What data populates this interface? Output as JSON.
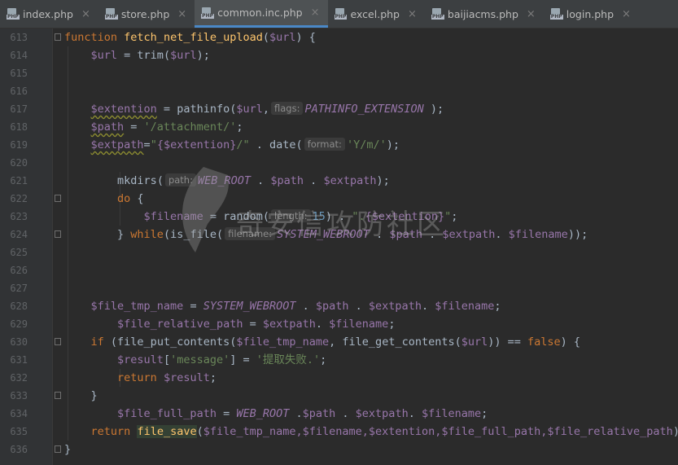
{
  "tabs": [
    {
      "label": "index.php",
      "active": false
    },
    {
      "label": "store.php",
      "active": false
    },
    {
      "label": "common.inc.php",
      "active": true
    },
    {
      "label": "excel.php",
      "active": false
    },
    {
      "label": "baijiacms.php",
      "active": false
    },
    {
      "label": "login.php",
      "active": false
    }
  ],
  "tab_icon_badge": "PHP",
  "close_glyph": "×",
  "line_numbers": [
    "613",
    "614",
    "615",
    "616",
    "617",
    "618",
    "619",
    "620",
    "621",
    "622",
    "623",
    "624",
    "625",
    "626",
    "627",
    "628",
    "629",
    "630",
    "631",
    "632",
    "633",
    "634",
    "635",
    "636"
  ],
  "hints": {
    "flags": "flags:",
    "format": "format:",
    "path": "path:",
    "length": "length:",
    "filename": "filename:"
  },
  "code": {
    "l613": {
      "kw": "function",
      "name": "fetch_net_file_upload",
      "open": "(",
      "var": "$url",
      "close": ") {"
    },
    "l614": {
      "var": "$url",
      "eq": " = ",
      "fn": "trim",
      "open": "(",
      "arg": "$url",
      "close": ");"
    },
    "l617": {
      "var": "$extention",
      "eq": " = ",
      "fn": "pathinfo",
      "open": "(",
      "arg": "$url",
      "comma": ",",
      "const": "PATHINFO_EXTENSION",
      "close": " );"
    },
    "l618": {
      "var": "$path",
      "eq": " = ",
      "str": "'/attachment/'",
      "close": ";"
    },
    "l619": {
      "var": "$extpath",
      "eq": "=",
      "str1": "\"",
      "inner": "{$extention}",
      "str2": "/\"",
      "dot": " . ",
      "fn": "date",
      "open": "(",
      "str": "'Y/m/'",
      "close": ");"
    },
    "l621": {
      "fn": "mkdirs",
      "open": "(",
      "const": "WEB_ROOT",
      "rest": " . ",
      "v1": "$path",
      "dot": " . ",
      "v2": "$extpath",
      "close": ");"
    },
    "l622": {
      "kw": "do",
      "rest": " {"
    },
    "l623": {
      "var": "$filename",
      "eq": " = ",
      "fn": "random",
      "open": "(",
      "num": "15",
      "mid": ") . ",
      "s1": "\".",
      "inner": "{$extention}",
      "s2": "\"",
      "close": ";"
    },
    "l624": {
      "brace": "} ",
      "kw": "while",
      "open": "(",
      "fn": "is_file",
      "open2": "(",
      "const": "SYSTEM_WEBROOT",
      "d1": " . ",
      "v1": "$path",
      "d2": " . ",
      "v2": "$extpath",
      "d3": ". ",
      "v3": "$filename",
      "close": "));"
    },
    "l628": {
      "var": "$file_tmp_name",
      "eq": " = ",
      "const": "SYSTEM_WEBROOT",
      "d1": " . ",
      "v1": "$path",
      "d2": " . ",
      "v2": "$extpath",
      "d3": ". ",
      "v3": "$filename",
      "close": ";"
    },
    "l629": {
      "var": "$file_relative_path",
      "eq": " = ",
      "v1": "$extpath",
      "d1": ". ",
      "v2": "$filename",
      "close": ";"
    },
    "l630": {
      "kw": "if",
      "p1": " (",
      "fn": "file_put_contents",
      "open": "(",
      "v1": "$file_tmp_name",
      "comma": ", ",
      "fn2": "file_get_contents",
      "open2": "(",
      "v2": "$url",
      "mid": ")) == ",
      "kw2": "false",
      "close": ") {"
    },
    "l631": {
      "var": "$result",
      "open": "[",
      "str": "'message'",
      "mid": "] = ",
      "str2": "'提取失败.'",
      "close": ";"
    },
    "l632": {
      "kw": "return",
      "sp": " ",
      "var": "$result",
      "close": ";"
    },
    "l633": {
      "brace": "}"
    },
    "l634": {
      "var": "$file_full_path",
      "eq": " = ",
      "const": "WEB_ROOT",
      "d1": " .",
      "v1": "$path",
      "d2": " . ",
      "v2": "$extpath",
      "d3": ". ",
      "v3": "$filename",
      "close": ";"
    },
    "l635": {
      "kw": "return",
      "sp": " ",
      "fn": "file_save",
      "open": "(",
      "args": "$file_tmp_name,$filename,$extention,$file_full_path,$file_relative_path",
      "close": ");"
    },
    "l636": {
      "brace": "}"
    }
  },
  "watermark_text": "奇安信攻防社区"
}
